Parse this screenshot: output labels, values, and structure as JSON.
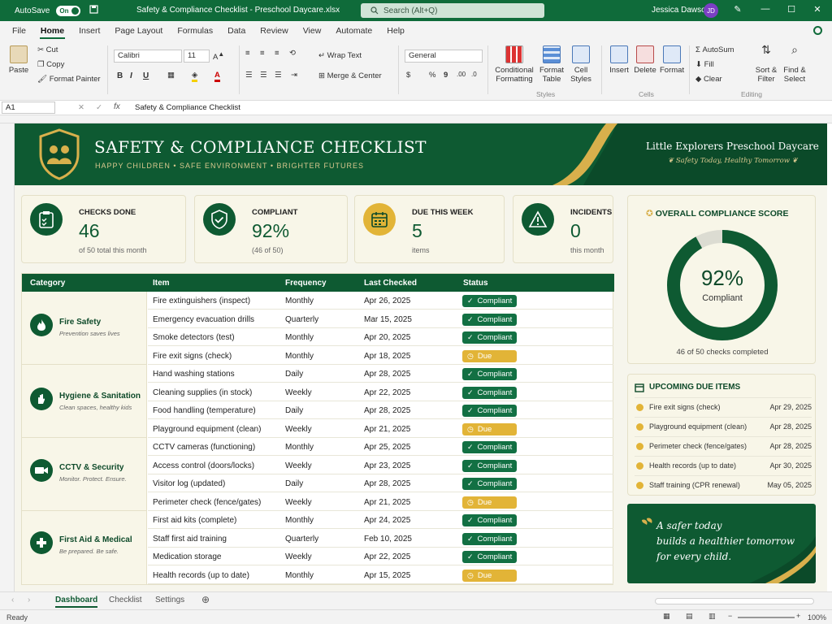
{
  "titlebar": {
    "autosave": "AutoSave",
    "toggle": "On",
    "title": "Safety & Compliance Checklist - Preschool Daycare.xlsx",
    "search": "Search (Alt+Q)",
    "user": "Jessica Dawson",
    "initials": "JD"
  },
  "menu": [
    "File",
    "Home",
    "Insert",
    "Page Layout",
    "Formulas",
    "Data",
    "Review",
    "View",
    "Automate",
    "Help"
  ],
  "ribbon": {
    "paste": "Paste",
    "cut": "Cut",
    "copy": "Copy",
    "format_painter": "Format Painter",
    "font": "Calibri",
    "size": "11",
    "wrap": "Wrap Text",
    "merge": "Merge & Center",
    "number_format": "General",
    "cond1": "Conditional",
    "cond2": "Formatting",
    "fmt_table1": "Format",
    "fmt_table2": "Table",
    "cell_styles1": "Cell",
    "cell_styles2": "Styles",
    "styles_group": "Styles",
    "insert": "Insert",
    "delete": "Delete",
    "format": "Format",
    "cells_group": "Cells",
    "autosum": "AutoSum",
    "fill": "Fill",
    "clear": "Clear",
    "sort1": "Sort &",
    "sort2": "Filter",
    "find1": "Find &",
    "find2": "Select",
    "editing_group": "Editing"
  },
  "formula_bar": {
    "cell": "A1",
    "fx": "fx",
    "value": "Safety & Compliance Checklist"
  },
  "banner": {
    "title": "SAFETY & COMPLIANCE CHECKLIST",
    "subtitle": "HAPPY CHILDREN  •  SAFE ENVIRONMENT  •  BRIGHTER FUTURES",
    "org": "Little Explorers Preschool Daycare",
    "tagline": "Safety Today, Healthy Tomorrow"
  },
  "kpis": [
    {
      "label": "CHECKS DONE",
      "value": "46",
      "sub": "of 50 total this month",
      "icon": "clipboard-icon"
    },
    {
      "label": "COMPLIANT",
      "value": "92%",
      "sub": "(46 of 50)",
      "icon": "shield-check-icon"
    },
    {
      "label": "DUE THIS WEEK",
      "value": "5",
      "sub": "items",
      "icon": "calendar-icon"
    },
    {
      "label": "INCIDENTS",
      "value": "0",
      "sub": "this month",
      "icon": "warning-icon"
    }
  ],
  "table": {
    "headers": [
      "Category",
      "Item",
      "Frequency",
      "Last Checked",
      "Status"
    ],
    "categories": [
      {
        "name": "Fire Safety",
        "sub": "Prevention saves lives",
        "icon": "flame-icon"
      },
      {
        "name": "Hygiene & Sanitation",
        "sub": "Clean spaces, healthy kids",
        "icon": "hands-icon"
      },
      {
        "name": "CCTV & Security",
        "sub": "Monitor. Protect. Ensure.",
        "icon": "camera-icon"
      },
      {
        "name": "First Aid & Medical",
        "sub": "Be prepared. Be safe.",
        "icon": "medical-cross-icon"
      }
    ],
    "rows": [
      {
        "item": "Fire extinguishers (inspect)",
        "freq": "Monthly",
        "date": "Apr 26, 2025",
        "status": "Compliant"
      },
      {
        "item": "Emergency evacuation drills",
        "freq": "Quarterly",
        "date": "Mar 15, 2025",
        "status": "Compliant"
      },
      {
        "item": "Smoke detectors (test)",
        "freq": "Monthly",
        "date": "Apr 20, 2025",
        "status": "Compliant"
      },
      {
        "item": "Fire exit signs (check)",
        "freq": "Monthly",
        "date": "Apr 18, 2025",
        "status": "Due"
      },
      {
        "item": "Hand washing stations",
        "freq": "Daily",
        "date": "Apr 28, 2025",
        "status": "Compliant"
      },
      {
        "item": "Cleaning supplies (in stock)",
        "freq": "Weekly",
        "date": "Apr 22, 2025",
        "status": "Compliant"
      },
      {
        "item": "Food handling (temperature)",
        "freq": "Daily",
        "date": "Apr 28, 2025",
        "status": "Compliant"
      },
      {
        "item": "Playground equipment (clean)",
        "freq": "Weekly",
        "date": "Apr 21, 2025",
        "status": "Due"
      },
      {
        "item": "CCTV cameras (functioning)",
        "freq": "Monthly",
        "date": "Apr 25, 2025",
        "status": "Compliant"
      },
      {
        "item": "Access control (doors/locks)",
        "freq": "Weekly",
        "date": "Apr 23, 2025",
        "status": "Compliant"
      },
      {
        "item": "Visitor log (updated)",
        "freq": "Daily",
        "date": "Apr 28, 2025",
        "status": "Compliant"
      },
      {
        "item": "Perimeter check (fence/gates)",
        "freq": "Weekly",
        "date": "Apr 21, 2025",
        "status": "Due"
      },
      {
        "item": "First aid kits (complete)",
        "freq": "Monthly",
        "date": "Apr 24, 2025",
        "status": "Compliant"
      },
      {
        "item": "Staff first aid training",
        "freq": "Quarterly",
        "date": "Feb 10, 2025",
        "status": "Compliant"
      },
      {
        "item": "Medication storage",
        "freq": "Weekly",
        "date": "Apr 22, 2025",
        "status": "Compliant"
      },
      {
        "item": "Health records (up to date)",
        "freq": "Monthly",
        "date": "Apr 15, 2025",
        "status": "Due"
      }
    ]
  },
  "score": {
    "title": "OVERALL COMPLIANCE SCORE",
    "pct": "92%",
    "label": "Compliant",
    "fraction": 0.92,
    "caption": "46 of 50 checks completed"
  },
  "upcoming": {
    "title": "UPCOMING DUE ITEMS",
    "items": [
      {
        "item": "Fire exit signs (check)",
        "date": "Apr 29, 2025"
      },
      {
        "item": "Playground equipment (clean)",
        "date": "Apr 28, 2025"
      },
      {
        "item": "Perimeter check (fence/gates)",
        "date": "Apr 28, 2025"
      },
      {
        "item": "Health records (up to date)",
        "date": "Apr 30, 2025"
      },
      {
        "item": "Staff training (CPR renewal)",
        "date": "May 05, 2025"
      }
    ]
  },
  "quote": [
    "A safer today",
    "builds a healthier tomorrow",
    "for every child."
  ],
  "sheet_tabs": [
    "Dashboard",
    "Checklist",
    "Settings"
  ],
  "status": {
    "ready": "Ready",
    "zoom": "100%"
  },
  "colors": {
    "primary": "#0e5a32",
    "accent": "#e2b437",
    "compliant": "#127043",
    "background": "#f6f5ec"
  }
}
